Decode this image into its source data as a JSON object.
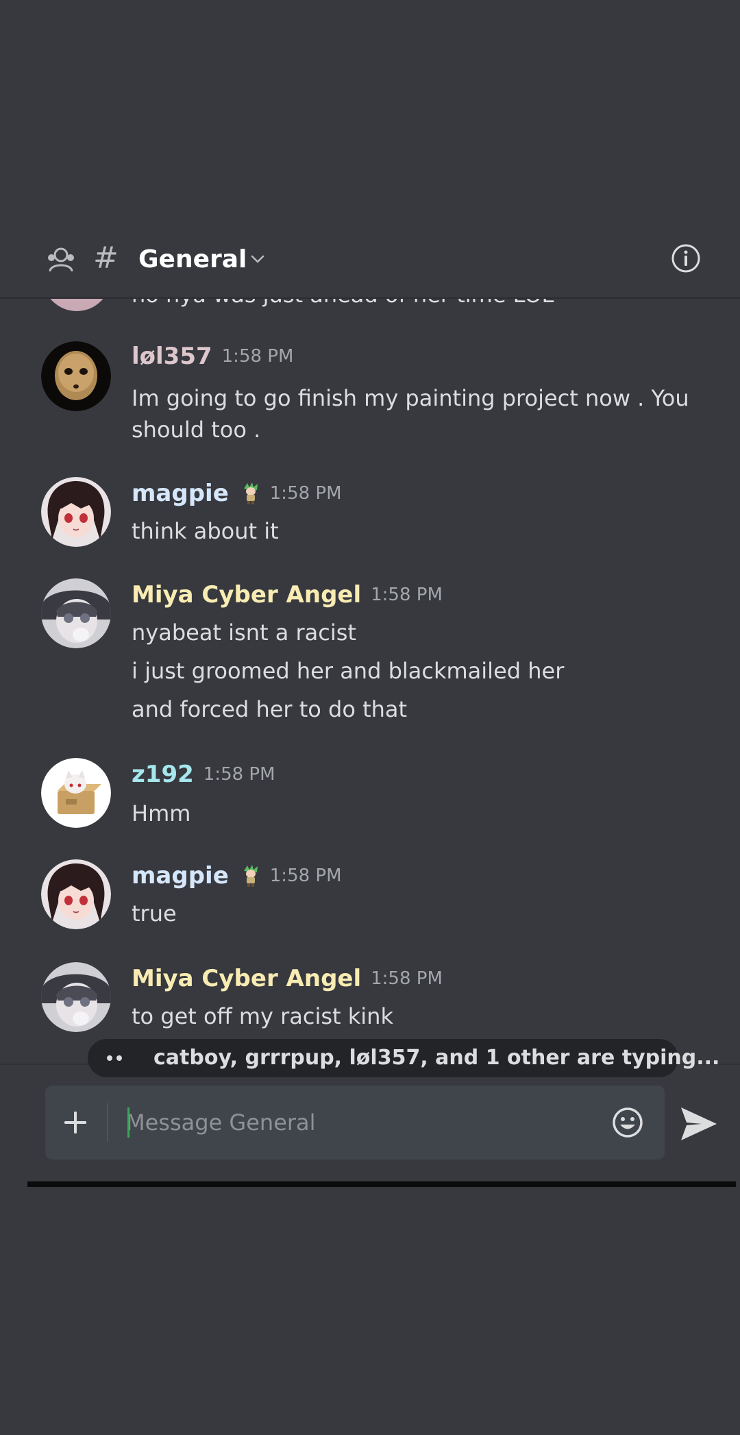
{
  "header": {
    "channel_name": "General",
    "hash": "#",
    "icons": [
      "members-icon",
      "hash-icon",
      "chevron-down-icon",
      "info-icon"
    ]
  },
  "clipped_message": {
    "text": "no nya was just ahead of her time LOL"
  },
  "messages": [
    {
      "username": "løl357",
      "username_color": "#ddc7cc",
      "timestamp": "1:58 PM",
      "lines": [
        "Im going to go finish my painting project now . You",
        "should too ."
      ],
      "has_badge": false
    },
    {
      "username": "magpie",
      "username_color": "#d6e7fb",
      "timestamp": "1:58 PM",
      "lines": [
        "think about it"
      ],
      "has_badge": true
    },
    {
      "username": "Miya Cyber Angel",
      "username_color": "#f8ecb2",
      "timestamp": "1:58 PM",
      "lines": [
        "nyabeat isnt a racist",
        "i just groomed her and blackmailed her",
        "and forced her to do that"
      ],
      "has_badge": false
    },
    {
      "username": "z192",
      "username_color": "#a6e7ee",
      "timestamp": "1:58 PM",
      "lines": [
        "Hmm"
      ],
      "has_badge": false
    },
    {
      "username": "magpie",
      "username_color": "#d6e7fb",
      "timestamp": "1:58 PM",
      "lines": [
        "true"
      ],
      "has_badge": true
    },
    {
      "username": "Miya Cyber Angel",
      "username_color": "#f8ecb2",
      "timestamp": "1:58 PM",
      "lines": [
        "to get off my racist kink"
      ],
      "has_badge": false
    }
  ],
  "typing": {
    "text": "catboy, grrrpup, løl357, and 1 other are typing..."
  },
  "composer": {
    "placeholder": "Message General",
    "icons": [
      "plus-icon",
      "emoji-icon",
      "send-icon"
    ]
  },
  "colors": {
    "background": "#37393f",
    "text": "#dcddde",
    "timestamp": "#a3a6aa",
    "composer": "#40444b",
    "typing_pill": "#232428"
  }
}
